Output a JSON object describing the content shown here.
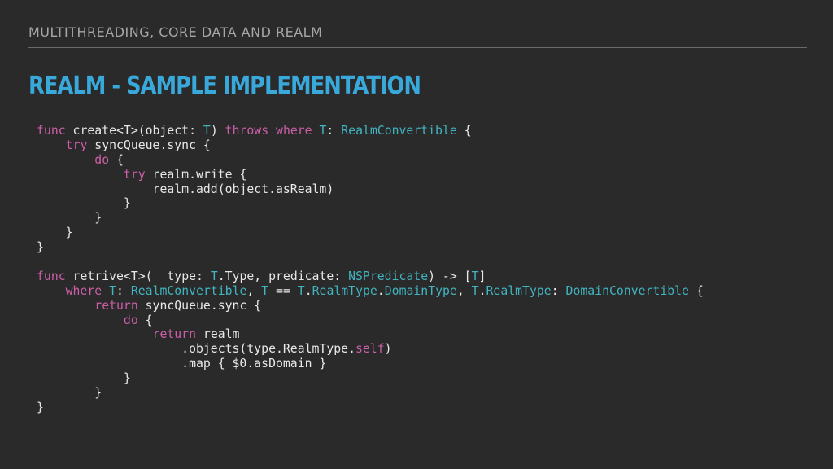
{
  "header": {
    "section_label": "MULTITHREADING, CORE DATA AND REALM"
  },
  "title": "REALM - SAMPLE IMPLEMENTATION",
  "colors": {
    "background": "#2a2a2a",
    "title": "#39a9dc",
    "header": "#a6a6a6",
    "code_text": "#e8e8e8",
    "code_keyword": "#cc5fa8",
    "code_type": "#41b4bf"
  },
  "code": {
    "language": "swift",
    "lines": [
      [
        [
          "kw",
          "func"
        ],
        [
          "text",
          " create<T>(object: "
        ],
        [
          "type",
          "T"
        ],
        [
          "text",
          ") "
        ],
        [
          "kw",
          "throws"
        ],
        [
          "text",
          " "
        ],
        [
          "kw",
          "where"
        ],
        [
          "text",
          " "
        ],
        [
          "type",
          "T"
        ],
        [
          "text",
          ": "
        ],
        [
          "type",
          "RealmConvertible"
        ],
        [
          "text",
          " {"
        ]
      ],
      [
        [
          "text",
          "    "
        ],
        [
          "kw",
          "try"
        ],
        [
          "text",
          " syncQueue.sync {"
        ]
      ],
      [
        [
          "text",
          "        "
        ],
        [
          "kw",
          "do"
        ],
        [
          "text",
          " {"
        ]
      ],
      [
        [
          "text",
          "            "
        ],
        [
          "kw",
          "try"
        ],
        [
          "text",
          " realm.write {"
        ]
      ],
      [
        [
          "text",
          "                realm.add(object.asRealm)"
        ]
      ],
      [
        [
          "text",
          "            }"
        ]
      ],
      [
        [
          "text",
          "        }"
        ]
      ],
      [
        [
          "text",
          "    }"
        ]
      ],
      [
        [
          "text",
          "}"
        ]
      ],
      [],
      [
        [
          "kw",
          "func"
        ],
        [
          "text",
          " retrive<T>("
        ],
        [
          "kw",
          "_"
        ],
        [
          "text",
          " type: "
        ],
        [
          "type",
          "T"
        ],
        [
          "text",
          ".Type, predicate: "
        ],
        [
          "type",
          "NSPredicate"
        ],
        [
          "text",
          ") -> ["
        ],
        [
          "type",
          "T"
        ],
        [
          "text",
          "]"
        ]
      ],
      [
        [
          "text",
          "    "
        ],
        [
          "kw",
          "where"
        ],
        [
          "text",
          " "
        ],
        [
          "type",
          "T"
        ],
        [
          "text",
          ": "
        ],
        [
          "type",
          "RealmConvertible"
        ],
        [
          "text",
          ", "
        ],
        [
          "type",
          "T"
        ],
        [
          "text",
          " == "
        ],
        [
          "type",
          "T"
        ],
        [
          "text",
          "."
        ],
        [
          "type",
          "RealmType"
        ],
        [
          "text",
          "."
        ],
        [
          "type",
          "DomainType"
        ],
        [
          "text",
          ", "
        ],
        [
          "type",
          "T"
        ],
        [
          "text",
          "."
        ],
        [
          "type",
          "RealmType"
        ],
        [
          "text",
          ": "
        ],
        [
          "type",
          "DomainConvertible"
        ],
        [
          "text",
          " {"
        ]
      ],
      [
        [
          "text",
          "        "
        ],
        [
          "kw",
          "return"
        ],
        [
          "text",
          " syncQueue.sync {"
        ]
      ],
      [
        [
          "text",
          "            "
        ],
        [
          "kw",
          "do"
        ],
        [
          "text",
          " {"
        ]
      ],
      [
        [
          "text",
          "                "
        ],
        [
          "kw",
          "return"
        ],
        [
          "text",
          " realm"
        ]
      ],
      [
        [
          "text",
          "                    .objects(type.RealmType."
        ],
        [
          "kw",
          "self"
        ],
        [
          "text",
          ")"
        ]
      ],
      [
        [
          "text",
          "                    .map { $0.asDomain }"
        ]
      ],
      [
        [
          "text",
          "            }"
        ]
      ],
      [
        [
          "text",
          "        }"
        ]
      ],
      [
        [
          "text",
          "}"
        ]
      ]
    ]
  }
}
